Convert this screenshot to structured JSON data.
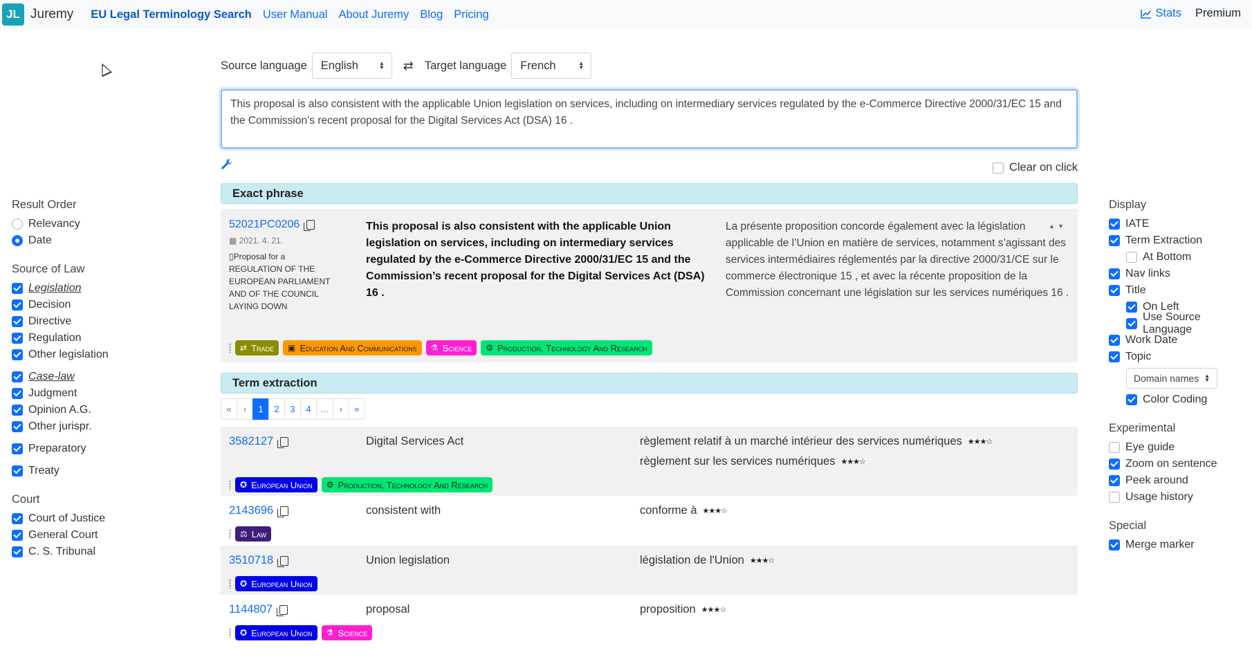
{
  "navbar": {
    "brand_logo": "JL",
    "brand_name": "Juremy",
    "links": [
      {
        "label": "EU Legal Terminology Search",
        "active": true
      },
      {
        "label": "User Manual"
      },
      {
        "label": "About Juremy"
      },
      {
        "label": "Blog"
      },
      {
        "label": "Pricing"
      }
    ],
    "stats_label": "Stats",
    "premium_label": "Premium"
  },
  "left": {
    "result_order_heading": "Result Order",
    "result_order": [
      {
        "label": "Relevancy",
        "checked": false
      },
      {
        "label": "Date",
        "checked": true
      }
    ],
    "source_heading": "Source of Law",
    "legislation": "Legislation",
    "decision": "Decision",
    "directive": "Directive",
    "regulation": "Regulation",
    "other_legislation": "Other legislation",
    "case_law": "Case-law",
    "judgment": "Judgment",
    "opinion": "Opinion A.G.",
    "other_jurispr": "Other jurispr.",
    "preparatory": "Preparatory",
    "treaty": "Treaty",
    "court_heading": "Court",
    "court_of_justice": "Court of Justice",
    "general_court": "General Court",
    "cs_tribunal": "C. S. Tribunal"
  },
  "right": {
    "display_heading": "Display",
    "iate": "IATE",
    "term_extraction": "Term Extraction",
    "at_bottom": "At Bottom",
    "nav_links": "Nav links",
    "title": "Title",
    "on_left": "On Left",
    "use_source_language": "Use Source Language",
    "work_date": "Work Date",
    "topic": "Topic",
    "domain_select": "Domain names",
    "color_coding": "Color Coding",
    "experimental_heading": "Experimental",
    "eye_guide": "Eye guide",
    "zoom_on_sentence": "Zoom on sentence",
    "peek_around": "Peek around",
    "usage_history": "Usage history",
    "special_heading": "Special",
    "merge_marker": "Merge marker"
  },
  "search": {
    "source_language_label": "Source language",
    "source_language": "English",
    "target_language_label": "Target language",
    "target_language": "French",
    "query": "This proposal is also consistent with the applicable Union legislation on services, including on intermediary services regulated by the e-Commerce Directive 2000/31/EC 15 and the Commission’s recent proposal for the Digital Services Act (DSA) 16 .",
    "clear_on_click": "Clear on click"
  },
  "exact": {
    "heading": "Exact phrase",
    "doc_id": "52021PC0206",
    "date": "2021. 4. 21.",
    "doc_title": "Proposal for a REGULATION OF THE EUROPEAN PARLIAMENT AND OF THE COUNCIL LAYING DOWN",
    "source": "This proposal is also consistent with the applicable Union legislation on services, including on intermediary services regulated by the e-Commerce Directive 2000/31/EC 15 and the Commission’s recent proposal for the Digital Services Act (DSA) 16 .",
    "target": "La présente proposition concorde également avec la législation applicable de l’Union en matière de services, notamment s’agissant des services intermédiaires réglementés par la directive 2000/31/CE sur le commerce électronique 15 , et avec la récente proposition de la Commission concernant une législation sur les services numériques 16 .",
    "tags": [
      "Trade",
      "Education And Communications",
      "Science",
      "Production, Technology And Research"
    ]
  },
  "terms": {
    "heading": "Term extraction",
    "pages": [
      "«",
      "‹",
      "1",
      "2",
      "3",
      "4",
      "...",
      "›",
      "»"
    ],
    "rows": [
      {
        "id": "3582127",
        "source": "Digital Services Act",
        "targets": [
          "règlement relatif à un marché intérieur des services numériques",
          "règlement sur les services numériques"
        ],
        "tags": [
          "European Union",
          "Production, Technology And Research"
        ]
      },
      {
        "id": "2143696",
        "source": "consistent with",
        "targets": [
          "conforme à"
        ],
        "tags": [
          "Law"
        ]
      },
      {
        "id": "3510718",
        "source": "Union legislation",
        "targets": [
          "législation de l'Union"
        ],
        "tags": [
          "European Union"
        ]
      },
      {
        "id": "1144807",
        "source": "proposal",
        "targets": [
          "proposition"
        ],
        "tags": [
          "European Union",
          "Science"
        ]
      }
    ],
    "stars": "★★★☆"
  },
  "colors": {
    "trade": "#8a8d00",
    "education": "#ff9800",
    "science": "#ff1fd2",
    "production": "#00e676",
    "eu": "#0000e6",
    "law": "#3d1f7a",
    "accent": "#0d6efd"
  }
}
